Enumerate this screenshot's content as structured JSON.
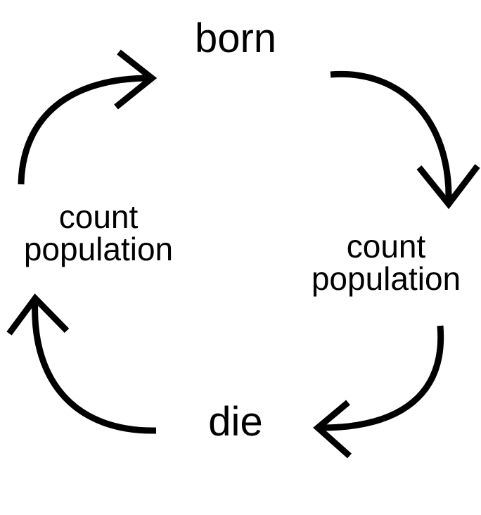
{
  "cycle": {
    "top": "born",
    "right": {
      "line1": "count",
      "line2": "population"
    },
    "bottom": "die",
    "left": {
      "line1": "count",
      "line2": "population"
    }
  },
  "colors": {
    "background": "#ffffff",
    "ink": "#000000"
  },
  "icons": [
    "arrow-born-to-count-icon",
    "arrow-count-to-die-icon",
    "arrow-die-to-count-icon",
    "arrow-count-to-born-icon"
  ]
}
